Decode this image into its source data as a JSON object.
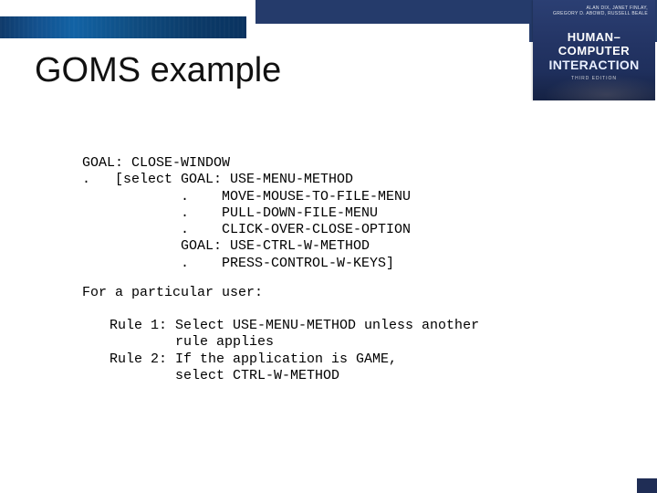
{
  "book": {
    "authors_line1": "ALAN DIX, JANET FINLAY,",
    "authors_line2": "GREGORY D. ABOWD, RUSSELL BEALE",
    "title_line1": "HUMAN–COMPUTER",
    "title_line2": "INTERACTION",
    "edition": "THIRD EDITION"
  },
  "slide": {
    "title": "GOMS example"
  },
  "goms": {
    "l1": "GOAL: CLOSE-WINDOW",
    "l2": ".   [select GOAL: USE-MENU-METHOD",
    "l3": "            .    MOVE-MOUSE-TO-FILE-MENU",
    "l4": "            .    PULL-DOWN-FILE-MENU",
    "l5": "            .    CLICK-OVER-CLOSE-OPTION",
    "l6": "            GOAL: USE-CTRL-W-METHOD",
    "l7": "            .    PRESS-CONTROL-W-KEYS]"
  },
  "subhead": "For a particular user:",
  "rules": {
    "r1a": "Rule 1: Select USE-MENU-METHOD unless another",
    "r1b": "        rule applies",
    "r2a": "Rule 2: If the application is GAME,",
    "r2b": "        select CTRL-W-METHOD"
  }
}
